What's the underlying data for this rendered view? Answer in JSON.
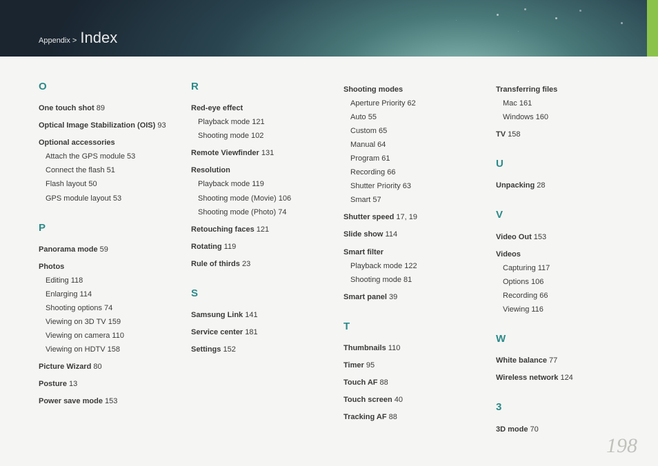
{
  "breadcrumb": {
    "section": "Appendix >",
    "title": "Index"
  },
  "page_number": "198",
  "columns": [
    [
      {
        "type": "letter",
        "text": "O"
      },
      {
        "type": "main",
        "label": "One touch shot",
        "page": "89"
      },
      {
        "type": "main",
        "label": "Optical Image Stabilization (OIS)",
        "page": "93"
      },
      {
        "type": "main",
        "label": "Optional accessories",
        "page": ""
      },
      {
        "type": "sub",
        "label": "Attach the GPS module",
        "page": "53"
      },
      {
        "type": "sub",
        "label": "Connect the flash",
        "page": "51"
      },
      {
        "type": "sub",
        "label": "Flash layout",
        "page": "50"
      },
      {
        "type": "sub",
        "label": "GPS module layout",
        "page": "53"
      },
      {
        "type": "letter",
        "text": "P"
      },
      {
        "type": "main",
        "label": "Panorama mode",
        "page": "59"
      },
      {
        "type": "main",
        "label": "Photos",
        "page": ""
      },
      {
        "type": "sub",
        "label": "Editing",
        "page": "118"
      },
      {
        "type": "sub",
        "label": "Enlarging",
        "page": "114"
      },
      {
        "type": "sub",
        "label": "Shooting options",
        "page": "74"
      },
      {
        "type": "sub",
        "label": "Viewing on 3D TV",
        "page": "159"
      },
      {
        "type": "sub",
        "label": "Viewing on camera",
        "page": "110"
      },
      {
        "type": "sub",
        "label": "Viewing on HDTV",
        "page": "158"
      },
      {
        "type": "main",
        "label": "Picture Wizard",
        "page": "80"
      },
      {
        "type": "main",
        "label": "Posture",
        "page": "13"
      },
      {
        "type": "main",
        "label": "Power save mode",
        "page": "153"
      }
    ],
    [
      {
        "type": "letter",
        "text": "R"
      },
      {
        "type": "main",
        "label": "Red-eye effect",
        "page": ""
      },
      {
        "type": "sub",
        "label": "Playback mode",
        "page": "121"
      },
      {
        "type": "sub",
        "label": "Shooting mode",
        "page": "102"
      },
      {
        "type": "main",
        "label": "Remote Viewfinder",
        "page": "131"
      },
      {
        "type": "main",
        "label": "Resolution",
        "page": ""
      },
      {
        "type": "sub",
        "label": "Playback mode",
        "page": "119"
      },
      {
        "type": "sub",
        "label": "Shooting mode (Movie)",
        "page": "106"
      },
      {
        "type": "sub",
        "label": "Shooting mode (Photo)",
        "page": "74"
      },
      {
        "type": "main",
        "label": "Retouching faces",
        "page": "121"
      },
      {
        "type": "main",
        "label": "Rotating",
        "page": "119"
      },
      {
        "type": "main",
        "label": "Rule of thirds",
        "page": "23"
      },
      {
        "type": "letter",
        "text": "S"
      },
      {
        "type": "main",
        "label": "Samsung Link",
        "page": "141"
      },
      {
        "type": "main",
        "label": "Service center",
        "page": "181"
      },
      {
        "type": "main",
        "label": "Settings",
        "page": "152"
      }
    ],
    [
      {
        "type": "main",
        "label": "Shooting modes",
        "page": ""
      },
      {
        "type": "sub",
        "label": "Aperture Priority",
        "page": "62"
      },
      {
        "type": "sub",
        "label": "Auto",
        "page": "55"
      },
      {
        "type": "sub",
        "label": "Custom",
        "page": "65"
      },
      {
        "type": "sub",
        "label": "Manual",
        "page": "64"
      },
      {
        "type": "sub",
        "label": "Program",
        "page": "61"
      },
      {
        "type": "sub",
        "label": "Recording",
        "page": "66"
      },
      {
        "type": "sub",
        "label": "Shutter Priority",
        "page": "63"
      },
      {
        "type": "sub",
        "label": "Smart",
        "page": "57"
      },
      {
        "type": "main",
        "label": "Shutter speed",
        "page": "17, 19"
      },
      {
        "type": "main",
        "label": "Slide show",
        "page": "114"
      },
      {
        "type": "main",
        "label": "Smart filter",
        "page": ""
      },
      {
        "type": "sub",
        "label": "Playback mode",
        "page": "122"
      },
      {
        "type": "sub",
        "label": "Shooting mode",
        "page": "81"
      },
      {
        "type": "main",
        "label": "Smart panel",
        "page": "39"
      },
      {
        "type": "letter",
        "text": "T"
      },
      {
        "type": "main",
        "label": "Thumbnails",
        "page": "110"
      },
      {
        "type": "main",
        "label": "Timer",
        "page": "95"
      },
      {
        "type": "main",
        "label": "Touch AF",
        "page": "88"
      },
      {
        "type": "main",
        "label": "Touch screen",
        "page": "40"
      },
      {
        "type": "main",
        "label": "Tracking AF",
        "page": "88"
      }
    ],
    [
      {
        "type": "main",
        "label": "Transferring files",
        "page": ""
      },
      {
        "type": "sub",
        "label": "Mac",
        "page": "161"
      },
      {
        "type": "sub",
        "label": "Windows",
        "page": "160"
      },
      {
        "type": "main",
        "label": "TV",
        "page": "158"
      },
      {
        "type": "letter",
        "text": "U"
      },
      {
        "type": "main",
        "label": "Unpacking",
        "page": "28"
      },
      {
        "type": "letter",
        "text": "V"
      },
      {
        "type": "main",
        "label": "Video Out",
        "page": "153"
      },
      {
        "type": "main",
        "label": "Videos",
        "page": ""
      },
      {
        "type": "sub",
        "label": "Capturing",
        "page": "117"
      },
      {
        "type": "sub",
        "label": "Options",
        "page": "106"
      },
      {
        "type": "sub",
        "label": "Recording",
        "page": "66"
      },
      {
        "type": "sub",
        "label": "Viewing",
        "page": "116"
      },
      {
        "type": "letter",
        "text": "W"
      },
      {
        "type": "main",
        "label": "White balance",
        "page": "77"
      },
      {
        "type": "main",
        "label": "Wireless network",
        "page": "124"
      },
      {
        "type": "letter",
        "text": "3"
      },
      {
        "type": "main",
        "label": "3D mode",
        "page": "70"
      }
    ]
  ]
}
